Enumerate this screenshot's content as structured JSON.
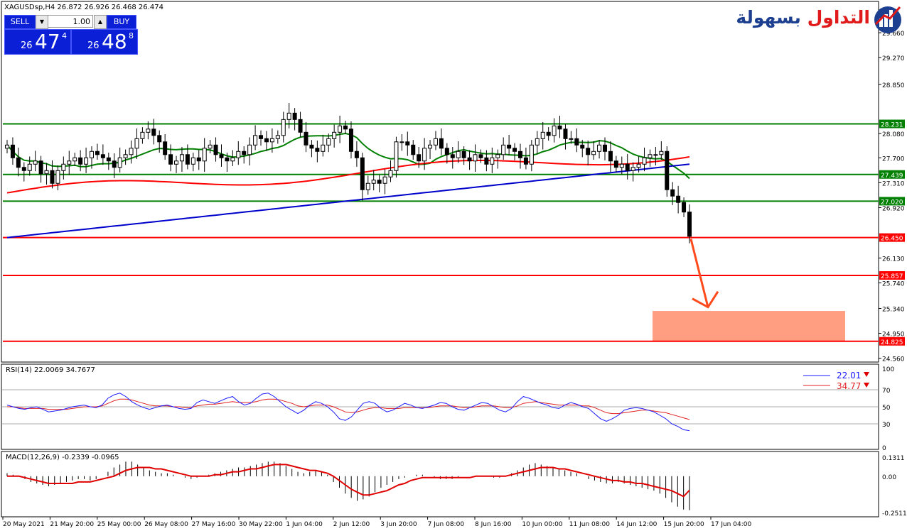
{
  "header": {
    "symbol_line": "XAGUSDsp,H4  26.872 26.926 26.468 26.474"
  },
  "trade_panel": {
    "sell_label": "SELL",
    "buy_label": "BUY",
    "lot": "1.00",
    "bid_small": "26",
    "bid_big": "47",
    "bid_sup": "4",
    "ask_small": "26",
    "ask_big": "48",
    "ask_sup": "8"
  },
  "logo": {
    "text_red": "التداول ",
    "text_blue": "بسهولة"
  },
  "chart_data": [
    {
      "type": "candlestick",
      "symbol": "XAGUSDsp",
      "timeframe": "H4",
      "ylim": [
        24.5,
        30.15
      ],
      "y_ticks": [
        "29.660",
        "29.270",
        "28.850",
        "28.080",
        "27.700",
        "27.310",
        "26.920",
        "26.130",
        "25.740",
        "25.340",
        "24.950",
        "24.560"
      ],
      "x_ticks": [
        "20 May 2021",
        "21 May 20:00",
        "25 May 00:00",
        "26 May 08:00",
        "27 May 16:00",
        "30 May 22:00",
        "1 Jun 04:00",
        "2 Jun 12:00",
        "3 Jun 20:00",
        "7 Jun 08:00",
        "8 Jun 16:00",
        "10 Jun 00:00",
        "11 Jun 08:00",
        "14 Jun 12:00",
        "15 Jun 20:00",
        "17 Jun 04:00"
      ],
      "green_levels": [
        {
          "value": 28.231,
          "label": "28.231"
        },
        {
          "value": 27.439,
          "label": "27.439"
        },
        {
          "value": 27.02,
          "label": "27.020"
        }
      ],
      "red_levels": [
        {
          "value": 26.45,
          "label": "26.450"
        },
        {
          "value": 25.857,
          "label": "25.857"
        },
        {
          "value": 24.825,
          "label": "24.825"
        }
      ],
      "target_zone": {
        "from": 24.83,
        "to": 25.3
      },
      "arrow": {
        "from_price": 26.45,
        "to_price": 25.36
      },
      "close": [
        27.9,
        27.7,
        27.55,
        27.5,
        27.6,
        27.65,
        27.45,
        27.5,
        27.3,
        27.5,
        27.6,
        27.65,
        27.7,
        27.6,
        27.7,
        27.8,
        27.75,
        27.7,
        27.65,
        27.55,
        27.7,
        27.75,
        27.85,
        28.0,
        28.1,
        28.15,
        28.05,
        27.95,
        27.75,
        27.6,
        27.65,
        27.75,
        27.6,
        27.7,
        27.65,
        27.85,
        27.9,
        27.75,
        27.7,
        27.65,
        27.7,
        27.8,
        27.75,
        27.9,
        28.05,
        28.0,
        27.95,
        28.0,
        28.05,
        28.3,
        28.4,
        28.3,
        28.1,
        27.9,
        27.85,
        27.8,
        27.9,
        28.0,
        28.1,
        28.2,
        28.15,
        27.8,
        27.7,
        27.2,
        27.3,
        27.35,
        27.3,
        27.4,
        27.5,
        27.95,
        27.95,
        27.9,
        27.75,
        27.65,
        27.85,
        27.9,
        28.0,
        27.85,
        27.75,
        27.7,
        27.8,
        27.7,
        27.65,
        27.75,
        27.7,
        27.6,
        27.7,
        27.75,
        27.9,
        27.85,
        27.8,
        27.7,
        27.6,
        27.9,
        28.0,
        28.1,
        28.05,
        28.2,
        28.15,
        28.0,
        28.0,
        27.9,
        27.85,
        27.75,
        27.8,
        27.9,
        27.8,
        27.65,
        27.55,
        27.6,
        27.5,
        27.55,
        27.6,
        27.7,
        27.75,
        27.75,
        27.8,
        27.2,
        27.1,
        27.0,
        26.85,
        26.47
      ],
      "ma_red_ends": [
        27.15,
        27.76
      ],
      "ma_blue_ends": [
        26.45,
        27.6
      ],
      "rsi": {
        "label": "RSI(14) 22.0069 34.7677",
        "ylim": [
          0,
          100
        ],
        "ticks": [
          "100",
          "70",
          "50",
          "30",
          "0"
        ],
        "levels": [
          70,
          50,
          30
        ],
        "rsi_value": "22.01",
        "signal_value": "34.77",
        "main": [
          52,
          50,
          48,
          47,
          49,
          50,
          47,
          44,
          45,
          46,
          48,
          50,
          51,
          52,
          50,
          49,
          52,
          60,
          64,
          66,
          62,
          56,
          52,
          49,
          47,
          49,
          51,
          52,
          50,
          48,
          47,
          48,
          55,
          58,
          56,
          54,
          57,
          60,
          62,
          56,
          52,
          54,
          60,
          65,
          66,
          62,
          56,
          50,
          46,
          42,
          46,
          52,
          56,
          54,
          50,
          44,
          36,
          34,
          38,
          46,
          54,
          56,
          54,
          48,
          44,
          46,
          50,
          54,
          52,
          49,
          48,
          50,
          52,
          55,
          54,
          50,
          47,
          46,
          49,
          52,
          55,
          54,
          50,
          46,
          44,
          48,
          56,
          62,
          60,
          57,
          54,
          52,
          49,
          48,
          52,
          55,
          53,
          50,
          48,
          42,
          36,
          33,
          36,
          40,
          46,
          48,
          49,
          48,
          46,
          44,
          40,
          36,
          30,
          27,
          23,
          22
        ],
        "signal": [
          50,
          50,
          49,
          48,
          48,
          48,
          48,
          47,
          47,
          47,
          47,
          48,
          49,
          50,
          50,
          50,
          51,
          54,
          57,
          59,
          59,
          58,
          56,
          54,
          52,
          51,
          51,
          51,
          50,
          50,
          49,
          49,
          51,
          52,
          53,
          53,
          54,
          55,
          56,
          55,
          55,
          55,
          56,
          58,
          59,
          59,
          58,
          56,
          54,
          51,
          50,
          51,
          52,
          52,
          52,
          50,
          47,
          44,
          43,
          44,
          46,
          48,
          49,
          49,
          48,
          48,
          48,
          49,
          49,
          49,
          49,
          49,
          50,
          51,
          51,
          51,
          50,
          49,
          49,
          50,
          51,
          51,
          51,
          50,
          49,
          49,
          51,
          54,
          55,
          56,
          55,
          54,
          53,
          52,
          52,
          52,
          52,
          51,
          51,
          49,
          46,
          43,
          42,
          42,
          43,
          44,
          45,
          46,
          46,
          45,
          44,
          43,
          41,
          39,
          37,
          35
        ]
      },
      "macd": {
        "label": "MACD(12,26,9) -0.2339 -0.0965",
        "ylim": [
          -0.28,
          0.17
        ],
        "ticks": [
          "0.1311",
          "0.00",
          "-0.2511"
        ],
        "histogram": [
          0.02,
          0.01,
          0.0,
          -0.02,
          -0.04,
          -0.05,
          -0.06,
          -0.07,
          -0.06,
          -0.05,
          -0.04,
          -0.03,
          -0.02,
          -0.02,
          -0.03,
          -0.02,
          0.0,
          0.03,
          0.06,
          0.08,
          0.1,
          0.1,
          0.08,
          0.06,
          0.04,
          0.03,
          0.02,
          0.02,
          0.01,
          0.0,
          -0.01,
          -0.02,
          -0.01,
          0.0,
          0.01,
          0.02,
          0.03,
          0.04,
          0.05,
          0.06,
          0.06,
          0.07,
          0.08,
          0.09,
          0.1,
          0.1,
          0.09,
          0.07,
          0.05,
          0.03,
          0.02,
          0.03,
          0.04,
          0.03,
          0.01,
          -0.04,
          -0.08,
          -0.12,
          -0.15,
          -0.17,
          -0.16,
          -0.14,
          -0.11,
          -0.08,
          -0.06,
          -0.04,
          -0.02,
          -0.01,
          0.0,
          0.01,
          0.01,
          0.0,
          -0.01,
          -0.02,
          -0.02,
          -0.02,
          -0.01,
          0.0,
          0.0,
          0.0,
          0.0,
          0.0,
          -0.01,
          -0.01,
          0.0,
          0.02,
          0.04,
          0.06,
          0.08,
          0.09,
          0.08,
          0.07,
          0.06,
          0.05,
          0.04,
          0.03,
          0.02,
          0.0,
          -0.02,
          -0.03,
          -0.04,
          -0.05,
          -0.05,
          -0.04,
          -0.05,
          -0.06,
          -0.07,
          -0.08,
          -0.09,
          -0.1,
          -0.12,
          -0.15,
          -0.18,
          -0.21,
          -0.23,
          -0.234
        ],
        "signal": [
          0.0,
          0.0,
          0.0,
          -0.01,
          -0.02,
          -0.03,
          -0.04,
          -0.05,
          -0.05,
          -0.05,
          -0.05,
          -0.05,
          -0.04,
          -0.04,
          -0.04,
          -0.03,
          -0.02,
          -0.01,
          0.0,
          0.02,
          0.04,
          0.05,
          0.06,
          0.06,
          0.06,
          0.05,
          0.05,
          0.04,
          0.03,
          0.02,
          0.01,
          0.0,
          0.0,
          0.0,
          0.0,
          0.01,
          0.01,
          0.02,
          0.03,
          0.03,
          0.04,
          0.05,
          0.05,
          0.06,
          0.07,
          0.08,
          0.08,
          0.08,
          0.07,
          0.06,
          0.05,
          0.04,
          0.04,
          0.03,
          0.02,
          0.0,
          -0.03,
          -0.06,
          -0.09,
          -0.11,
          -0.13,
          -0.13,
          -0.12,
          -0.11,
          -0.1,
          -0.08,
          -0.06,
          -0.05,
          -0.03,
          -0.02,
          -0.01,
          -0.01,
          -0.01,
          -0.01,
          -0.01,
          -0.01,
          -0.01,
          -0.01,
          -0.01,
          0.0,
          0.0,
          0.0,
          0.0,
          0.0,
          0.0,
          0.01,
          0.02,
          0.03,
          0.04,
          0.05,
          0.06,
          0.06,
          0.06,
          0.05,
          0.05,
          0.04,
          0.03,
          0.02,
          0.01,
          0.0,
          -0.01,
          -0.02,
          -0.03,
          -0.03,
          -0.04,
          -0.04,
          -0.05,
          -0.05,
          -0.06,
          -0.07,
          -0.08,
          -0.09,
          -0.1,
          -0.12,
          -0.14,
          -0.0965
        ]
      }
    }
  ],
  "colors": {
    "green_level": "#008000",
    "red_level": "#ff0000",
    "ma_green": "#008000",
    "ma_red": "#ff0000",
    "ma_blue": "#0000cc",
    "zone": "#ff9e80",
    "arrow": "#ff4a1c",
    "rsi_line": "#1a1aff",
    "rsi_signal": "#e02020",
    "macd_hist": "#000000",
    "macd_signal": "#e00000"
  }
}
